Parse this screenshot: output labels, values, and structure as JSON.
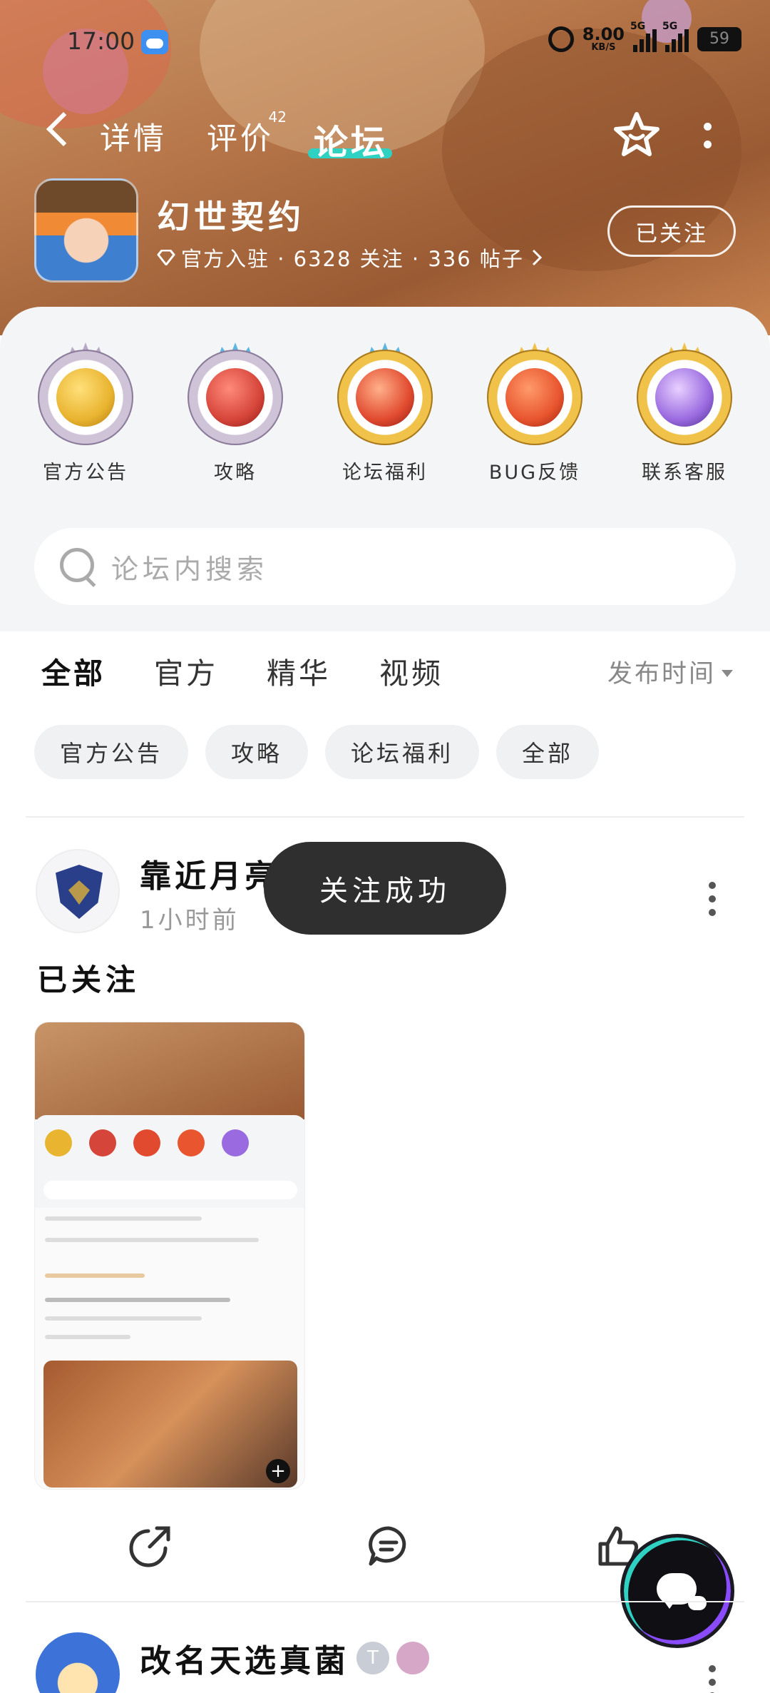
{
  "status_bar": {
    "time": "17:00",
    "net_speed_value": "8.00",
    "net_speed_unit": "KB/S",
    "sim1_label": "5G",
    "sim2_label": "5G",
    "battery": "59"
  },
  "nav": {
    "tabs": [
      {
        "label": "详情"
      },
      {
        "label": "评价",
        "badge": "42"
      },
      {
        "label": "论坛"
      }
    ],
    "active_tab": "论坛"
  },
  "app": {
    "name": "幻世契约",
    "meta": "官方入驻 · 6328 关注 · 336 帖子",
    "follow_label": "已关注"
  },
  "quick_links": [
    {
      "label": "官方公告",
      "color": "#e9b430"
    },
    {
      "label": "攻略",
      "color": "#d6453a"
    },
    {
      "label": "论坛福利",
      "color": "#e14a2f"
    },
    {
      "label": "BUG反馈",
      "color": "#e8552e"
    },
    {
      "label": "联系客服",
      "color": "#9a6be0"
    }
  ],
  "search": {
    "placeholder": "论坛内搜索"
  },
  "feed_tabs": [
    {
      "label": "全部"
    },
    {
      "label": "官方"
    },
    {
      "label": "精华"
    },
    {
      "label": "视频"
    }
  ],
  "sort": {
    "label": "发布时间"
  },
  "chips": [
    {
      "label": "官方公告"
    },
    {
      "label": "攻略"
    },
    {
      "label": "论坛福利"
    },
    {
      "label": "全部"
    }
  ],
  "post": {
    "author": "靠近月亮",
    "time": "1小时前",
    "title": "已关注"
  },
  "toast": {
    "text": "关注成功"
  },
  "post2": {
    "author": "改名天选真菌",
    "badge": "T"
  }
}
